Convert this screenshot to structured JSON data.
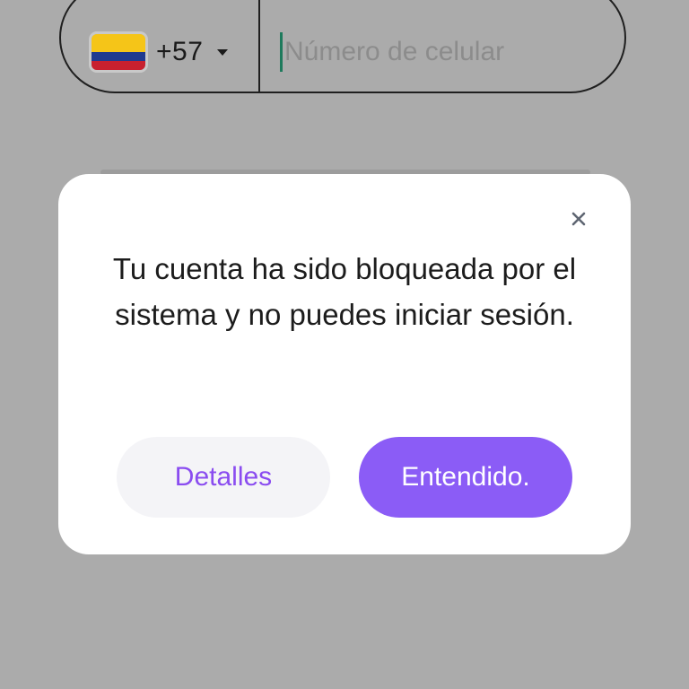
{
  "phone_field": {
    "dial_code": "+57",
    "placeholder": "Número de celular",
    "value": "",
    "flag_icon": "colombia-flag-icon",
    "flag_colors": {
      "yellow": "#f5c518",
      "blue": "#1f3a8f",
      "red": "#c8202f"
    }
  },
  "modal": {
    "message": "Tu cuenta ha sido bloqueada por el sistema y no puedes iniciar sesión.",
    "close_icon": "close-icon",
    "secondary_button": "Detalles",
    "primary_button": "Entendido."
  },
  "colors": {
    "overlay": "#ababab",
    "accent": "#8b5cf6",
    "accent_text": "#8a4cf0",
    "secondary_button_bg": "#f4f4f7"
  }
}
